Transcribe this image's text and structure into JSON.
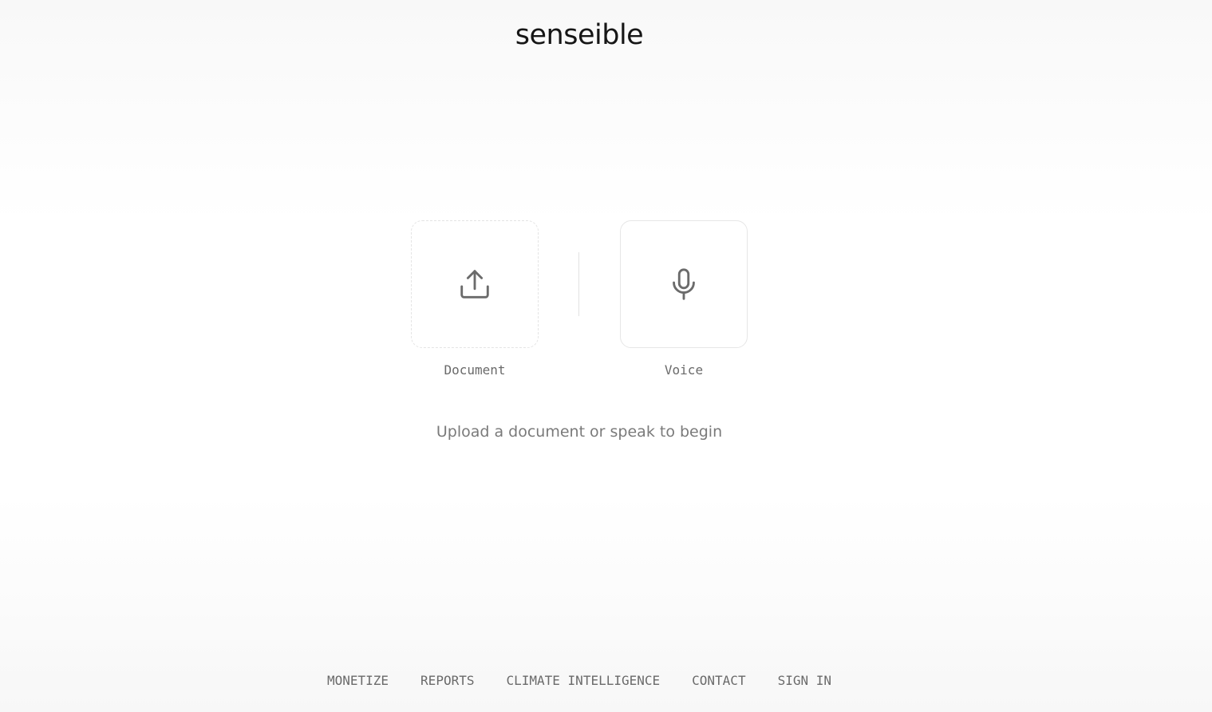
{
  "header": {
    "brand": "senseible"
  },
  "main": {
    "document": {
      "label": "Document",
      "icon": "upload-icon"
    },
    "voice": {
      "label": "Voice",
      "icon": "microphone-icon"
    },
    "hint": "Upload a document or speak to begin"
  },
  "footer": {
    "links": [
      "MONETIZE",
      "REPORTS",
      "CLIMATE INTELLIGENCE",
      "CONTACT",
      "SIGN IN"
    ]
  },
  "colors": {
    "text_primary": "#161616",
    "text_secondary": "#6a6a6a",
    "border": "#e4e4e4"
  }
}
